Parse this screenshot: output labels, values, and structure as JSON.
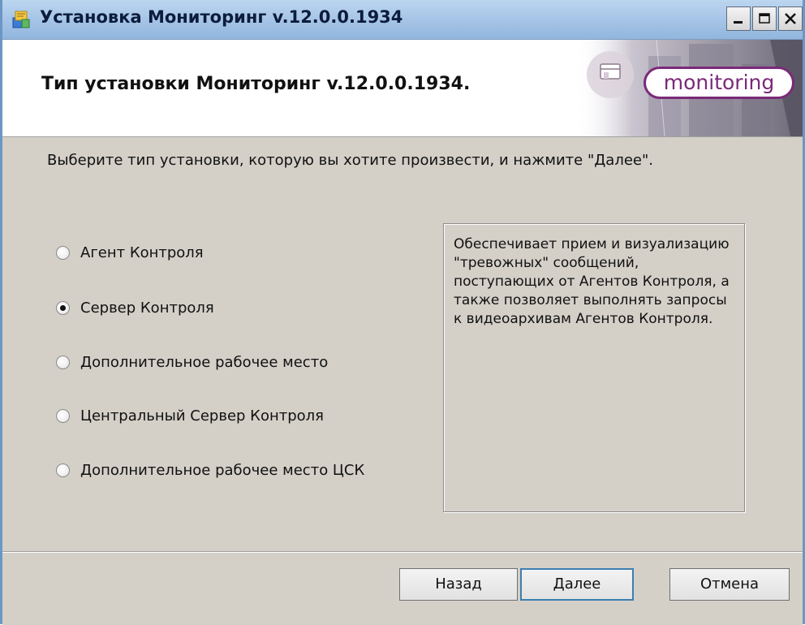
{
  "window": {
    "title": "Установка Мониторинг v.12.0.0.1934",
    "app_icon": "installer-icon",
    "controls": [
      "minimize-icon",
      "maximize-icon",
      "close-icon"
    ]
  },
  "header": {
    "title": "Тип установки Мониторинг v.12.0.0.1934.",
    "logo_text": "monitoring"
  },
  "content": {
    "instruction": "Выберите тип установки, которую вы хотите произвести, и нажмите \"Далее\".",
    "options": [
      {
        "label": "Агент Контроля",
        "selected": false
      },
      {
        "label": "Сервер Контроля",
        "selected": true
      },
      {
        "label": "Дополнительное рабочее место",
        "selected": false
      },
      {
        "label": "Центральный Сервер Контроля",
        "selected": false
      },
      {
        "label": "Дополнительное рабочее место ЦСК",
        "selected": false
      }
    ],
    "description": "Обеспечивает прием и визуализацию \"тревожных\" сообщений, поступающих от Агентов Контроля, а также позволяет выполнять запросы к видеоархивам Агентов Контроля."
  },
  "buttons": {
    "back": "Назад",
    "next": "Далее",
    "cancel": "Отмена"
  },
  "colors": {
    "titlebar": "#a4c3e6",
    "logo": "#7a2a78",
    "default_button_border": "#3c7fb1"
  }
}
